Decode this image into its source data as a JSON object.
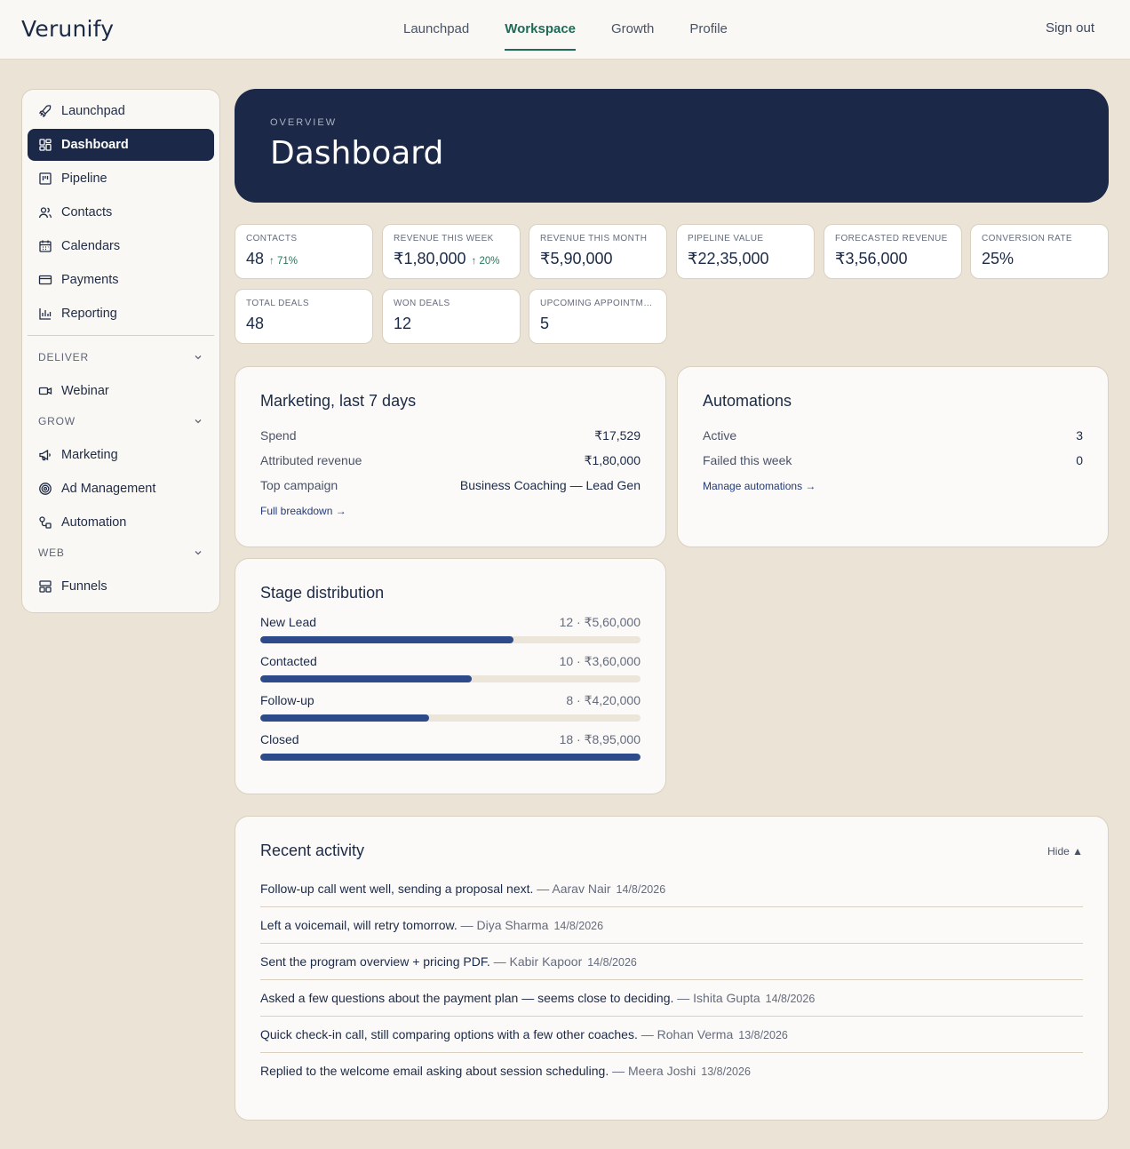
{
  "app": {
    "name": "Verunify"
  },
  "topnav": {
    "tabs": [
      {
        "label": "Launchpad",
        "active": false
      },
      {
        "label": "Workspace",
        "active": true
      },
      {
        "label": "Growth",
        "active": false
      },
      {
        "label": "Profile",
        "active": false
      }
    ],
    "signout_label": "Sign out"
  },
  "sidebar": {
    "items": [
      {
        "label": "Launchpad",
        "icon": "rocket-icon"
      },
      {
        "label": "Dashboard",
        "icon": "dashboard-icon",
        "active": true
      },
      {
        "label": "Pipeline",
        "icon": "pipeline-icon"
      },
      {
        "label": "Contacts",
        "icon": "contacts-icon"
      },
      {
        "label": "Calendars",
        "icon": "calendar-icon"
      },
      {
        "label": "Payments",
        "icon": "credit-card-icon"
      },
      {
        "label": "Reporting",
        "icon": "bar-chart-icon"
      }
    ],
    "groups": [
      {
        "label": "DELIVER",
        "items": [
          {
            "label": "Webinar",
            "icon": "video-icon"
          }
        ]
      },
      {
        "label": "GROW",
        "items": [
          {
            "label": "Marketing",
            "icon": "megaphone-icon"
          },
          {
            "label": "Ad Management",
            "icon": "target-icon"
          },
          {
            "label": "Automation",
            "icon": "workflow-icon"
          }
        ]
      },
      {
        "label": "WEB",
        "items": [
          {
            "label": "Funnels",
            "icon": "layout-icon"
          }
        ]
      }
    ]
  },
  "hero": {
    "eyebrow": "OVERVIEW",
    "title": "Dashboard"
  },
  "kpis": [
    {
      "label": "CONTACTS",
      "value": "48",
      "delta": "↑ 71%"
    },
    {
      "label": "REVENUE THIS WEEK",
      "value": "₹1,80,000",
      "delta": "↑ 20%"
    },
    {
      "label": "REVENUE THIS MONTH",
      "value": "₹5,90,000",
      "delta": ""
    },
    {
      "label": "PIPELINE VALUE",
      "value": "₹22,35,000",
      "delta": ""
    },
    {
      "label": "FORECASTED REVENUE",
      "value": "₹3,56,000",
      "delta": ""
    },
    {
      "label": "CONVERSION RATE",
      "value": "25%",
      "delta": ""
    },
    {
      "label": "TOTAL DEALS",
      "value": "48",
      "delta": ""
    },
    {
      "label": "WON DEALS",
      "value": "12",
      "delta": ""
    },
    {
      "label": "UPCOMING APPOINTMENTS",
      "value": "5",
      "delta": ""
    }
  ],
  "marketing": {
    "title": "Marketing, last 7 days",
    "rows": [
      {
        "k": "Spend",
        "v": "₹17,529"
      },
      {
        "k": "Attributed revenue",
        "v": "₹1,80,000"
      },
      {
        "k": "Top campaign",
        "v": "Business Coaching — Lead Gen"
      }
    ],
    "link": "Full breakdown →"
  },
  "automations": {
    "title": "Automations",
    "rows": [
      {
        "k": "Active",
        "v": "3"
      },
      {
        "k": "Failed this week",
        "v": "0"
      }
    ],
    "link": "Manage automations →"
  },
  "stages": {
    "title": "Stage distribution",
    "items": [
      {
        "name": "New Lead",
        "meta": "12 · ₹5,60,000",
        "fill": 0.665
      },
      {
        "name": "Contacted",
        "meta": "10 · ₹3,60,000",
        "fill": 0.555
      },
      {
        "name": "Follow-up",
        "meta": "8 · ₹4,20,000",
        "fill": 0.445
      },
      {
        "name": "Closed",
        "meta": "18 · ₹8,95,000",
        "fill": 1.0
      }
    ]
  },
  "activity": {
    "title": "Recent activity",
    "hide_label": "Hide ▲",
    "items": [
      {
        "text": "Follow-up call went well, sending a proposal next.",
        "who": "— Aarav Nair",
        "date": "14/8/2026"
      },
      {
        "text": "Left a voicemail, will retry tomorrow.",
        "who": "— Diya Sharma",
        "date": "14/8/2026"
      },
      {
        "text": "Sent the program overview + pricing PDF.",
        "who": "— Kabir Kapoor",
        "date": "14/8/2026"
      },
      {
        "text": "Asked a few questions about the payment plan — seems close to deciding.",
        "who": "— Ishita Gupta",
        "date": "14/8/2026"
      },
      {
        "text": "Quick check-in call, still comparing options with a few other coaches.",
        "who": "— Rohan Verma",
        "date": "13/8/2026"
      },
      {
        "text": "Replied to the welcome email asking about session scheduling.",
        "who": "— Meera Joshi",
        "date": "13/8/2026"
      }
    ]
  },
  "colors": {
    "navy": "#1b2847",
    "accent_green": "#1f6b57",
    "bar": "#2d4a8a",
    "background": "#ebe3d6"
  }
}
